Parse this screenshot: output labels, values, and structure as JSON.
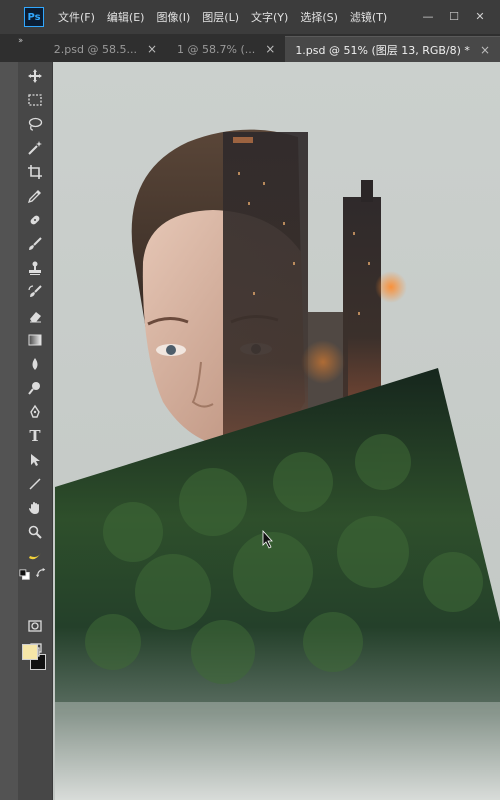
{
  "app": {
    "logo": "Ps"
  },
  "menu": [
    "文件(F)",
    "编辑(E)",
    "图像(I)",
    "图层(L)",
    "文字(Y)",
    "选择(S)",
    "滤镜(T)"
  ],
  "window_controls": {
    "minimize": "—",
    "maximize": "☐",
    "close": "✕"
  },
  "tabs": [
    {
      "label": "2.psd @ 58.5...",
      "close": "×",
      "active": false
    },
    {
      "label": "1 @ 58.7% (...",
      "close": "×",
      "active": false
    },
    {
      "label": "1.psd @ 51% (图层 13, RGB/8) *",
      "close": "×",
      "active": true
    }
  ],
  "toolbar": {
    "collapse_glyph": "››",
    "tools": [
      "move-icon",
      "marquee-icon",
      "lasso-icon",
      "magic-wand-icon",
      "crop-icon",
      "eyedropper-icon",
      "healing-brush-icon",
      "brush-icon",
      "clone-stamp-icon",
      "history-brush-icon",
      "eraser-icon",
      "gradient-icon",
      "blur-icon",
      "dodge-icon",
      "pen-icon",
      "type-icon",
      "path-selection-icon",
      "line-icon",
      "hand-icon",
      "zoom-icon",
      "banana-icon",
      "default-colors-icon",
      "swap-colors-icon",
      "quick-mask-icon",
      "screen-mode-icon"
    ],
    "type_tool_glyph": "T",
    "foreground_color": "#f5e6a8",
    "background_color": "#111111"
  },
  "canvas": {
    "background_color": "#c8ccc9",
    "image_description": "double-exposure: woman's portrait blended with city skyline, overlaid with rotated forest layer"
  }
}
